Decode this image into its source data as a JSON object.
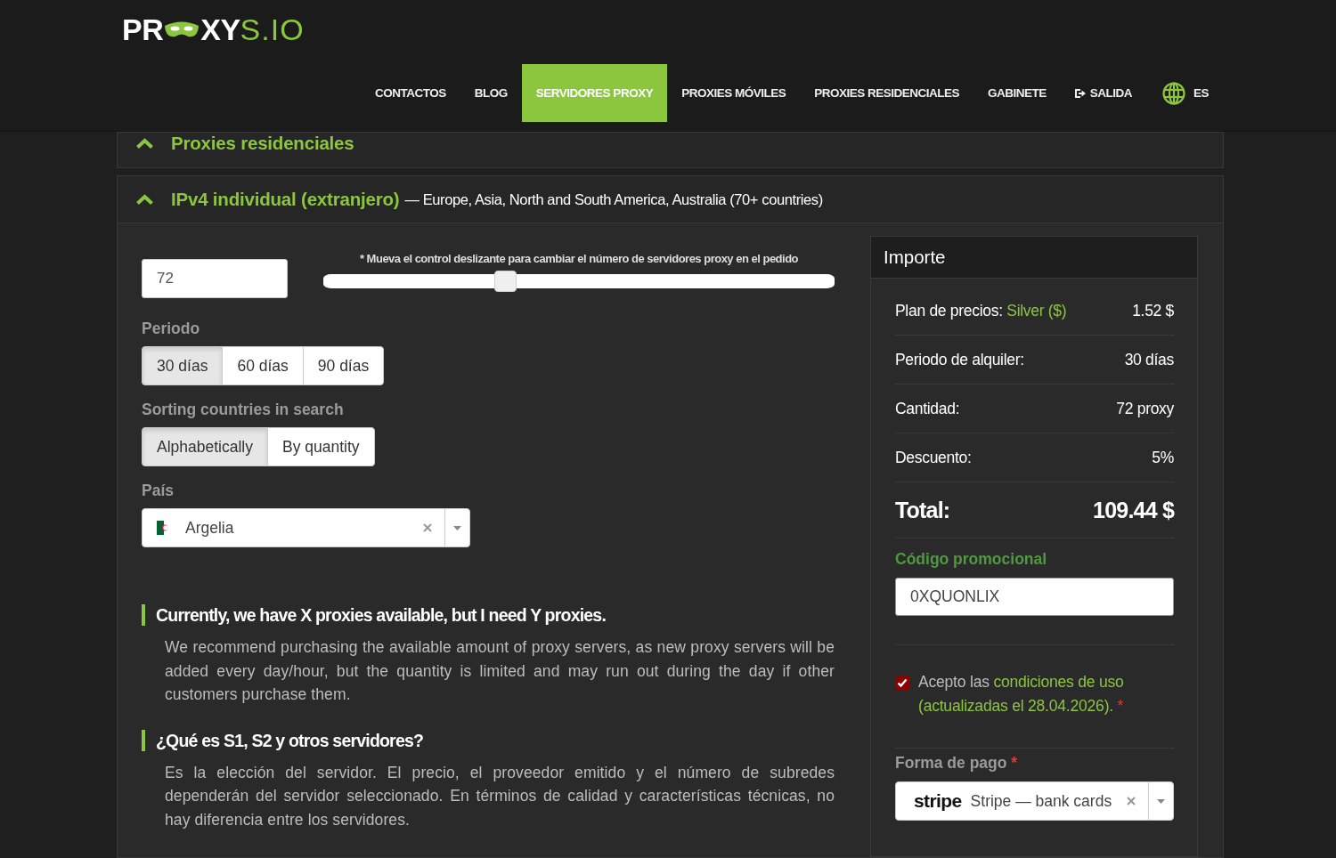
{
  "header": {
    "logo": {
      "start": "PR",
      "middle": "XY",
      "end": "S.IO"
    },
    "nav": [
      {
        "label": "CONTACTOS",
        "kind": "link",
        "selected": false
      },
      {
        "label": "BLOG",
        "kind": "link",
        "selected": false
      },
      {
        "label": "SERVIDORES PROXY",
        "kind": "link",
        "selected": true
      },
      {
        "label": "PROXIES MÓVILES",
        "kind": "link",
        "selected": false
      },
      {
        "label": "PROXIES RESIDENCIALES",
        "kind": "link",
        "selected": false
      },
      {
        "label": "GABINETE",
        "kind": "link",
        "selected": false
      },
      {
        "label": "SALIDA",
        "kind": "exit",
        "selected": false
      }
    ],
    "language": "ES"
  },
  "sections": [
    {
      "title": "Proxies residenciales"
    },
    {
      "title": "IPv4 individual (extranjero)",
      "subtitle": "— Europe, Asia, North and South America, Australia (70+ countries)",
      "form": {
        "quantity": "72",
        "slider": {
          "hint": "* Mueva el control deslizante para cambiar el número de servidores proxy en el pedido",
          "level": 0.35
        },
        "groups": [
          {
            "label": "Periodo",
            "options": [
              {
                "label": "30 días",
                "selected": true
              },
              {
                "label": "60 días",
                "selected": false
              },
              {
                "label": "90 días",
                "selected": false
              }
            ]
          },
          {
            "label": "Sorting countries in search",
            "options": [
              {
                "label": "Alphabetically",
                "selected": true
              },
              {
                "label": "By quantity",
                "selected": false
              }
            ]
          }
        ],
        "country": {
          "label": "País",
          "value": "Argelia"
        }
      },
      "faq": [
        {
          "question": "Currently, we have X proxies available, but I need Y proxies.",
          "answer": "We recommend purchasing the available amount of proxy servers, as new proxy servers will be added every day/hour, but the quantity is limited and may run out during the day if other customers purchase them."
        },
        {
          "question": "¿Qué es S1, S2 y otros servidores?",
          "answer": "Es la elección del servidor. El precio, el proveedor emitido y el número de subredes dependerán del servidor seleccionado. En términos de calidad y características técnicas, no hay diferencia entre los servidores."
        }
      ],
      "summary": {
        "title": "Importe",
        "rows": [
          {
            "label": "Plan de precios:",
            "highlight": "Silver ($)",
            "value": "1.52 $"
          },
          {
            "label": "Periodo de alquiler:",
            "value": "30 días"
          },
          {
            "label": "Cantidad:",
            "value": "72 proxy"
          },
          {
            "label": "Descuento:",
            "value": "5%"
          }
        ],
        "total": {
          "label": "Total:",
          "value": "109.44 $"
        },
        "promo": {
          "label": "Código promocional",
          "value": "0XQUONLIX"
        },
        "terms": {
          "checked": true,
          "text": "Acepto las",
          "link": "condiciones de uso",
          "note": "(actualizadas el 28.04.2026).",
          "required": "*"
        },
        "payment": {
          "label": "Forma de pago",
          "required": "*",
          "logo": "stripe",
          "value": "Stripe — bank cards"
        }
      }
    }
  ]
}
